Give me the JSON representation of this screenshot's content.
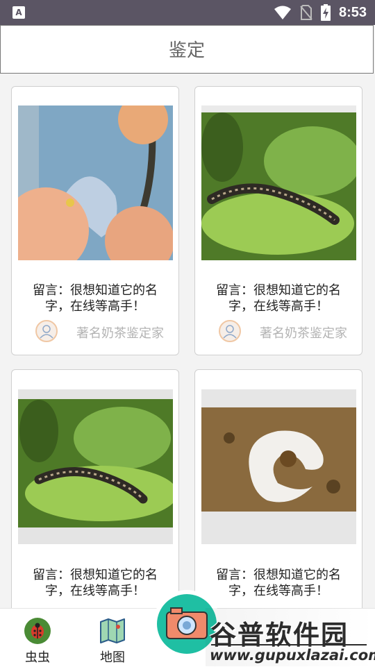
{
  "status_bar": {
    "time": "8:53",
    "app_badge": "A"
  },
  "header": {
    "title": "鉴定"
  },
  "cards": [
    {
      "comment": "留言：很想知道它的名字，在线等高手！",
      "author": "著名奶茶鉴定家",
      "image": "moth-silk-cocoon-on-fruit"
    },
    {
      "comment": "留言：很想知道它的名字，在线等高手！",
      "author": "著名奶茶鉴定家",
      "image": "caterpillar-on-leaf"
    },
    {
      "comment": "留言：很想知道它的名字，在线等高手！",
      "author": "",
      "image": "caterpillar-on-leaf"
    },
    {
      "comment": "留言：很想知道它的名字，在线等高手！",
      "author": "",
      "image": "white-grub-in-soil"
    }
  ],
  "bottom_nav": {
    "items": [
      {
        "label": "虫虫",
        "icon": "ladybug-icon"
      },
      {
        "label": "地图",
        "icon": "map-icon"
      }
    ],
    "camera_icon": "camera-icon"
  },
  "watermark": {
    "text": "谷普软件园",
    "url": "www.gupuxlazai.com"
  }
}
